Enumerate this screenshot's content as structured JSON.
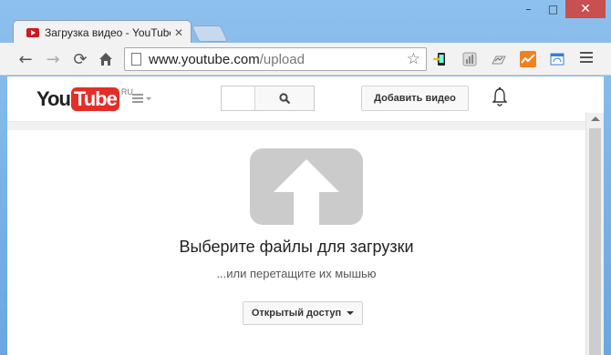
{
  "browser": {
    "tab_title": "Загрузка видео - YouTube",
    "url_host": "www.youtube.com",
    "url_path": "/upload",
    "back_icon": "arrow-left-icon",
    "forward_icon": "arrow-right-icon",
    "reload_icon": "reload-icon",
    "home_icon": "home-icon"
  },
  "masthead": {
    "logo_you": "You",
    "logo_tube": "Tube",
    "logo_region": "RU",
    "upload_label": "Добавить видео"
  },
  "upload": {
    "heading": "Выберите файлы для загрузки",
    "subheading": "...или перетащите их мышью",
    "privacy_label": "Открытый доступ"
  },
  "colors": {
    "youtube_red": "#e52d27",
    "icon_gray": "#c9c9c9",
    "frame_blue": "#6fa8dc"
  }
}
